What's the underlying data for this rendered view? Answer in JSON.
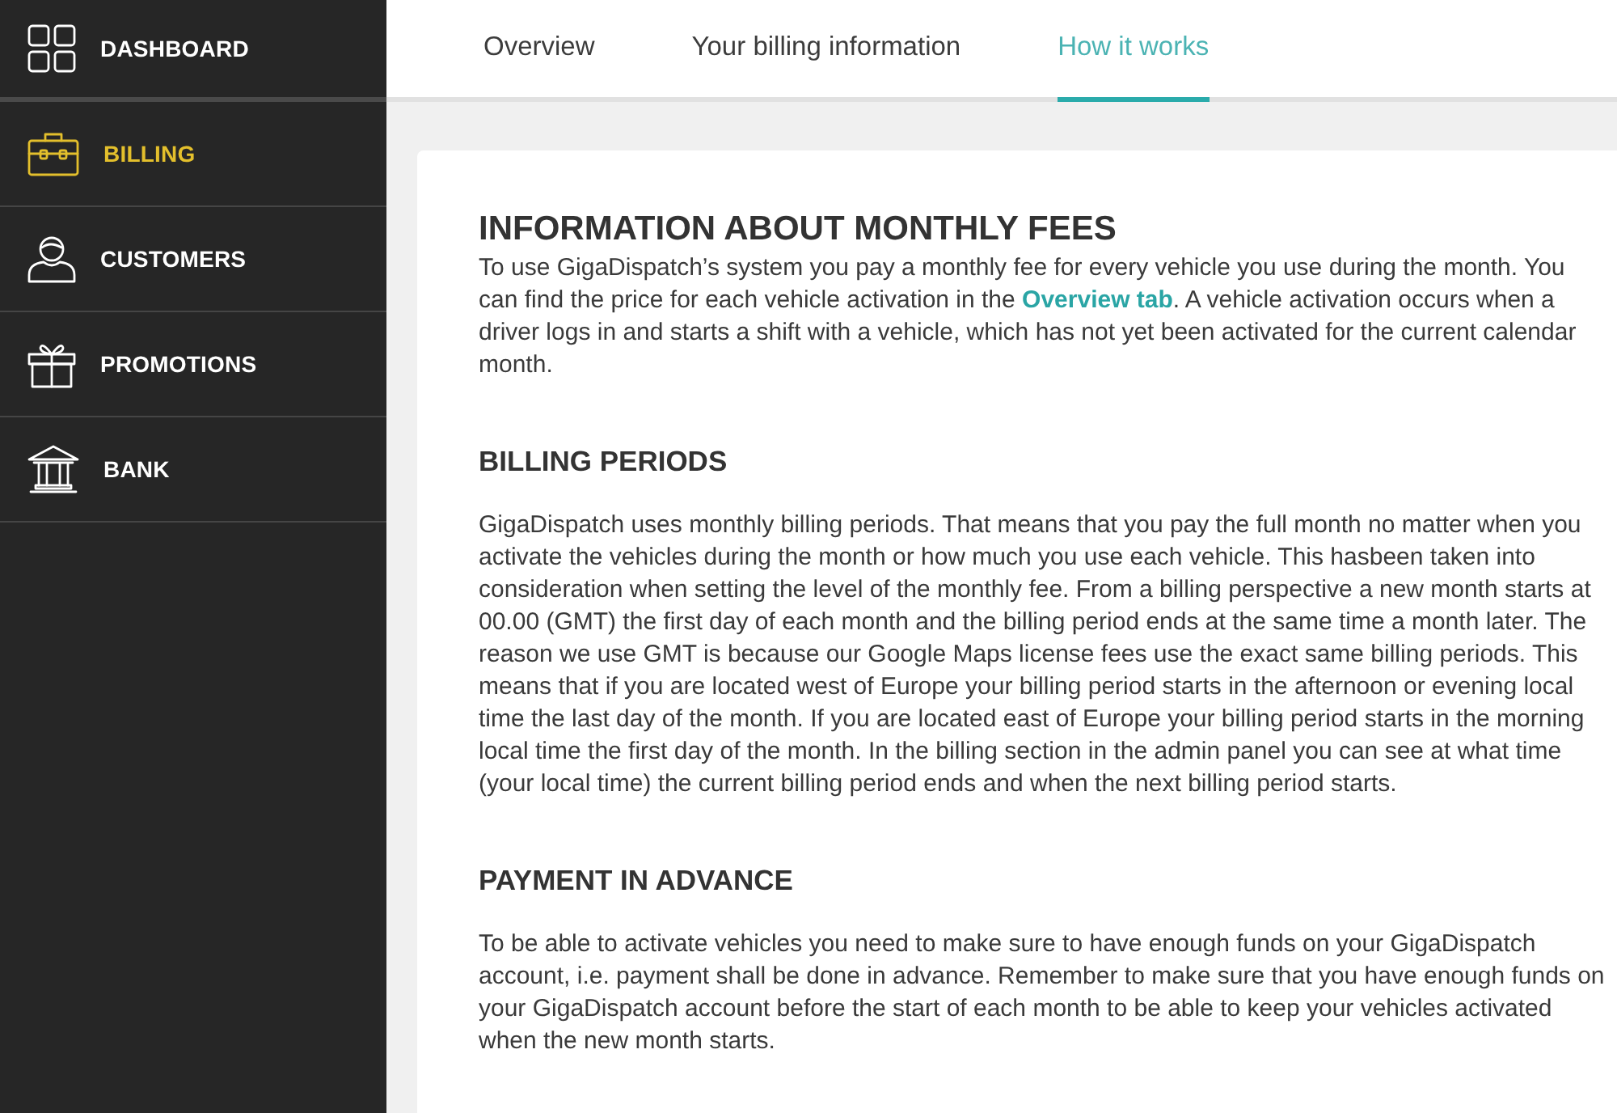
{
  "sidebar": {
    "items": [
      {
        "label": "DASHBOARD",
        "selected": false
      },
      {
        "label": "BILLING",
        "selected": true
      },
      {
        "label": "CUSTOMERS",
        "selected": false
      },
      {
        "label": "PROMOTIONS",
        "selected": false
      },
      {
        "label": "BANK",
        "selected": false
      }
    ]
  },
  "tabs": [
    {
      "label": "Overview",
      "selected": false
    },
    {
      "label": "Your billing information",
      "selected": false
    },
    {
      "label": "How it works",
      "selected": true
    }
  ],
  "sections": [
    {
      "kind": "title",
      "heading": "INFORMATION ABOUT MONTHLY FEES",
      "paragraph": [
        {
          "kind": "text",
          "text": "To use GigaDispatch’s system you pay a monthly fee for every vehicle you use during the month. You can find the price for each vehicle activation in the "
        },
        {
          "kind": "link",
          "text": "Overview tab"
        },
        {
          "kind": "text",
          "text": ". A vehicle activation occurs when a driver logs in and starts a shift with a vehicle, which has not yet been activated for the current calendar month."
        }
      ]
    },
    {
      "kind": "heading",
      "heading": "BILLING PERIODS",
      "paragraph": [
        {
          "kind": "text",
          "text": "GigaDispatch uses monthly billing periods. That means that you pay the full month no matter when you activate the vehicles during the month or how much you use each vehicle. This hasbeen taken into consideration when setting the level of the monthly fee. From a billing perspective a new month starts at 00.00 (GMT) the first day of each month and the billing period ends at the same time a month later. The reason we use GMT is because our Google Maps license fees use the exact same billing periods. This means that if you are located west of Europe your billing period starts in the afternoon or evening local time the last day of the month. If you are located east of Europe your billing period starts in the morning local time the first day of the month. In the billing section in the admin panel you can see at what time (your local time) the current billing period ends and when the next billing period starts."
        }
      ]
    },
    {
      "kind": "heading",
      "heading": "PAYMENT IN ADVANCE",
      "paragraph": [
        {
          "kind": "text",
          "text": "To be able to activate vehicles you need to make sure to have enough funds on your GigaDispatch account, i.e. payment shall be done in advance. Remember to make sure that you have enough funds on your GigaDispatch account before the start of each month to be able to keep your vehicles activated when the new month starts."
        }
      ]
    }
  ]
}
